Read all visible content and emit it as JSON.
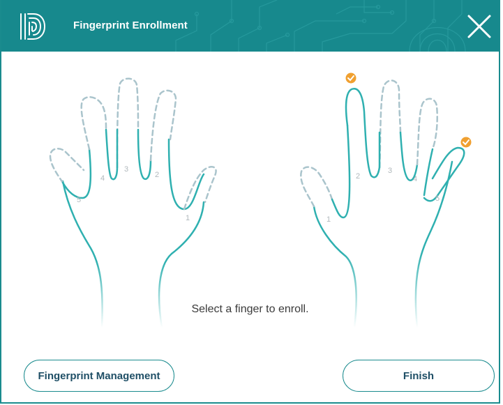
{
  "window": {
    "title": "Fingerprint Enrollment",
    "accent_color": "#1a8b8e",
    "enrolled_badge_color": "#f0a030"
  },
  "icons": {
    "logo": "fingerprint-logo-icon",
    "close": "close-icon",
    "enrolled": "checkmark-badge-icon"
  },
  "left_hand": {
    "fingers": [
      {
        "number": "1",
        "enrolled": false
      },
      {
        "number": "2",
        "enrolled": false
      },
      {
        "number": "3",
        "enrolled": false
      },
      {
        "number": "4",
        "enrolled": false
      },
      {
        "number": "5",
        "enrolled": false
      }
    ]
  },
  "right_hand": {
    "fingers": [
      {
        "number": "1",
        "enrolled": false
      },
      {
        "number": "2",
        "enrolled": true
      },
      {
        "number": "3",
        "enrolled": false
      },
      {
        "number": "4",
        "enrolled": false
      },
      {
        "number": "5",
        "enrolled": true
      }
    ]
  },
  "prompt": "Select a finger to enroll.",
  "buttons": {
    "manage": "Fingerprint Management",
    "finish": "Finish"
  }
}
